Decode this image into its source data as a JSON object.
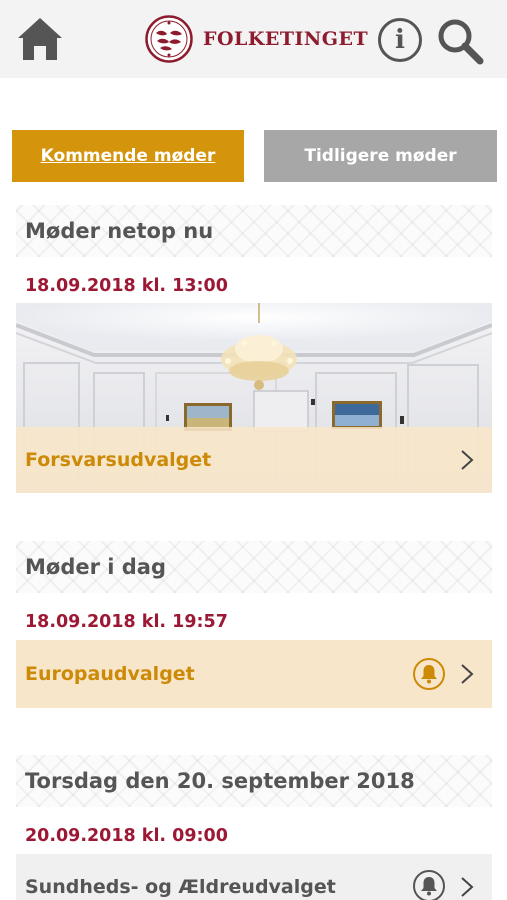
{
  "header": {
    "logo_text": "FOLKETINGET",
    "info_label": "i",
    "icons": {
      "home": "home-icon",
      "seal": "seal-icon",
      "info": "info-icon",
      "search": "search-icon"
    }
  },
  "tabs": {
    "upcoming": "Kommende møder",
    "past": "Tidligere møder"
  },
  "sections": [
    {
      "title": "Møder netop nu",
      "meetings": [
        {
          "datetime": "18.09.2018 kl. 13:00",
          "committee": "Forsvarsudvalget"
        }
      ]
    },
    {
      "title": "Møder i dag",
      "meetings": [
        {
          "datetime": "18.09.2018 kl. 19:57",
          "committee": "Europaudvalget"
        }
      ]
    },
    {
      "title": "Torsdag den 20. september 2018",
      "meetings": [
        {
          "datetime": "20.09.2018 kl. 09:00",
          "committee": "Sundheds- og Ældreudvalget"
        }
      ]
    }
  ],
  "colors": {
    "accent": "#d4940b",
    "date_red": "#9c1935",
    "brand": "#8c1c2e",
    "inactive_tab": "#a7a7a7",
    "highlight_row": "#f8e6cb"
  }
}
